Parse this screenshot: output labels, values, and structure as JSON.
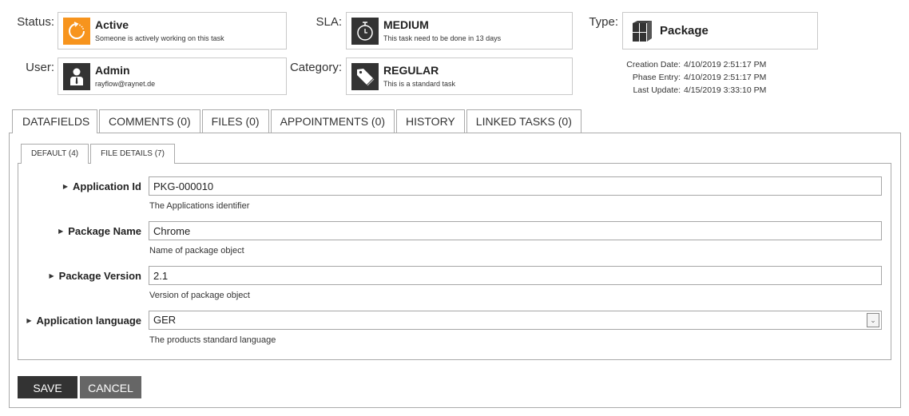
{
  "header": {
    "status": {
      "label": "Status:",
      "title": "Active",
      "subtitle": "Someone is actively working on this task",
      "icon": "refresh-circle-icon",
      "icon_bg": "#f7941d"
    },
    "user": {
      "label": "User:",
      "title": "Admin",
      "subtitle": "rayflow@raynet.de",
      "icon": "user-icon",
      "icon_bg": "#333333"
    },
    "sla": {
      "label": "SLA:",
      "title": "MEDIUM",
      "subtitle": "This task need to be done in 13 days",
      "icon": "stopwatch-icon",
      "icon_bg": "#333333"
    },
    "category": {
      "label": "Category:",
      "title": "REGULAR",
      "subtitle": "This is a standard task",
      "icon": "tag-icon",
      "icon_bg": "#333333"
    },
    "type": {
      "label": "Type:",
      "title": "Package",
      "icon": "package-icon"
    },
    "dates": [
      {
        "key": "Creation Date:",
        "value": "4/10/2019 2:51:17 PM"
      },
      {
        "key": "Phase Entry:",
        "value": "4/10/2019 2:51:17 PM"
      },
      {
        "key": "Last Update:",
        "value": "4/15/2019 3:33:10 PM"
      }
    ]
  },
  "tabs": [
    {
      "label": "DATAFIELDS",
      "active": true
    },
    {
      "label": "COMMENTS (0)",
      "active": false
    },
    {
      "label": "FILES (0)",
      "active": false
    },
    {
      "label": "APPOINTMENTS (0)",
      "active": false
    },
    {
      "label": "HISTORY",
      "active": false
    },
    {
      "label": "LINKED TASKS (0)",
      "active": false
    }
  ],
  "subtabs": [
    {
      "label": "DEFAULT (4)",
      "active": true
    },
    {
      "label": "FILE DETAILS (7)",
      "active": false
    }
  ],
  "fields": [
    {
      "label": "Application Id",
      "value": "PKG-000010",
      "help": "The Applications identifier",
      "type": "text"
    },
    {
      "label": "Package Name",
      "value": "Chrome",
      "help": "Name of package object",
      "type": "text"
    },
    {
      "label": "Package Version",
      "value": "2.1",
      "help": "Version of package object",
      "type": "text"
    },
    {
      "label": "Application language",
      "value": "GER",
      "help": "The products standard language",
      "type": "select"
    }
  ],
  "actions": {
    "save_label": "SAVE",
    "cancel_label": "CANCEL",
    "save_color": "#333333",
    "cancel_color": "#666666"
  }
}
